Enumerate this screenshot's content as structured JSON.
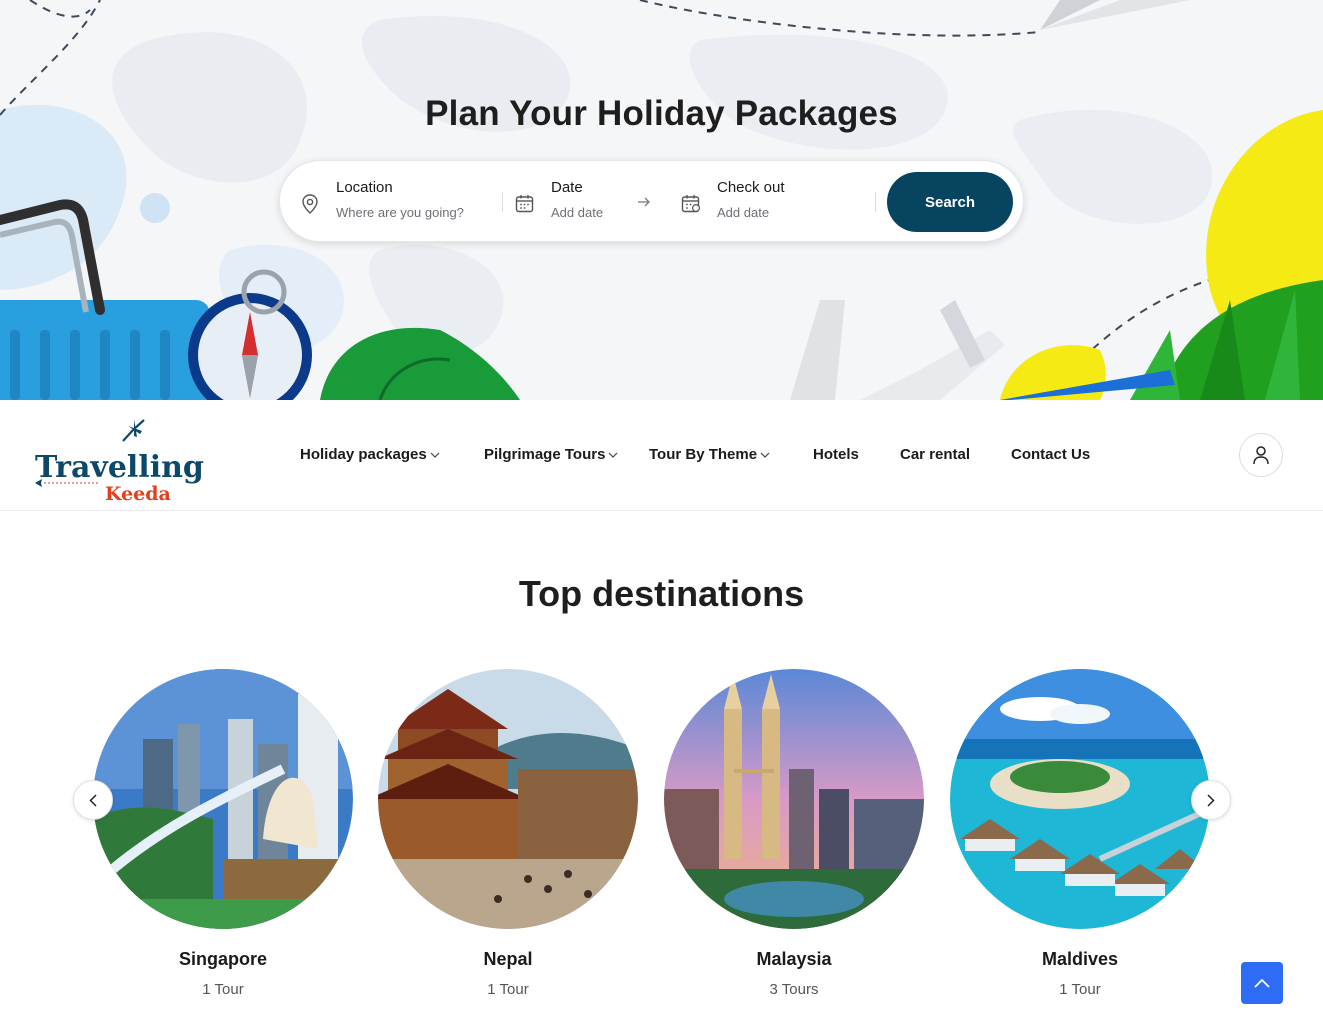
{
  "hero": {
    "title": "Plan Your Holiday Packages",
    "search": {
      "location_label": "Location",
      "location_placeholder": "Where are you going?",
      "date_label": "Date",
      "date_placeholder": "Add date",
      "checkout_label": "Check out",
      "checkout_placeholder": "Add date",
      "button_label": "Search"
    }
  },
  "nav": {
    "logo": {
      "top": "Travelling",
      "bottom": "Keeda"
    },
    "items": [
      {
        "label": "Holiday packages",
        "has_dropdown": true
      },
      {
        "label": "Pilgrimage Tours",
        "has_dropdown": true
      },
      {
        "label": "Tour By Theme",
        "has_dropdown": true
      },
      {
        "label": "Hotels",
        "has_dropdown": false
      },
      {
        "label": "Car rental",
        "has_dropdown": false
      },
      {
        "label": "Contact Us",
        "has_dropdown": false
      }
    ],
    "user_icon": "user-icon"
  },
  "destinations": {
    "title": "Top destinations",
    "items": [
      {
        "name": "Singapore",
        "count": "1 Tour"
      },
      {
        "name": "Nepal",
        "count": "1 Tour"
      },
      {
        "name": "Malaysia",
        "count": "3 Tours"
      },
      {
        "name": "Maldives",
        "count": "1 Tour"
      }
    ],
    "prev_icon": "chevron-left-icon",
    "next_icon": "chevron-right-icon"
  },
  "colors": {
    "brand_dark": "#06445f",
    "logo_red": "#e0401c",
    "scroll_top": "#2e6cf6"
  },
  "scroll_top_icon": "chevron-up-icon"
}
